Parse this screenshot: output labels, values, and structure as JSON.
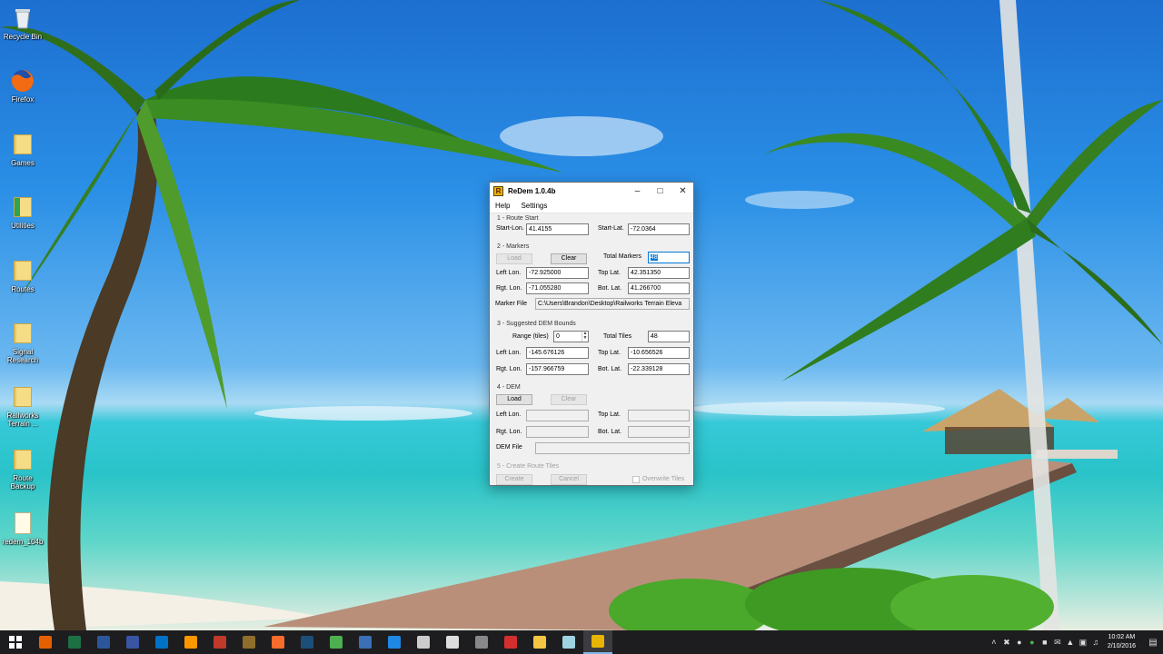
{
  "desktop": {
    "icons": [
      {
        "label": "Recycle Bin",
        "icon": "recycle-bin-icon"
      },
      {
        "label": "Firefox",
        "icon": "firefox-icon"
      },
      {
        "label": "Games",
        "icon": "folder-icon"
      },
      {
        "label": "Utilities",
        "icon": "folder-icon"
      },
      {
        "label": "Routes",
        "icon": "folder-icon"
      },
      {
        "label": "Signal",
        "label2": "Research",
        "icon": "folder-icon"
      },
      {
        "label": "Railworks",
        "label2": "Terrain ...",
        "icon": "folder-icon"
      },
      {
        "label": "Route",
        "label2": "Backup",
        "icon": "folder-icon"
      },
      {
        "label": "redem_104b",
        "icon": "file-icon"
      }
    ]
  },
  "window": {
    "title": "ReDem 1.0.4b",
    "app_icon_letter": "R",
    "menu": [
      "Help",
      "Settings"
    ],
    "sec1": {
      "title": "1 - Route Start",
      "start_lon_label": "Start-Lon.",
      "start_lon": "41.4155",
      "start_lat_label": "Start-Lat.",
      "start_lat": "-72.0364"
    },
    "sec2": {
      "title": "2 - Markers",
      "load": "Load",
      "clear": "Clear",
      "total_markers_label": "Total Markers",
      "total_markers": "48",
      "left_lon_label": "Left Lon.",
      "left_lon": "-72.925000",
      "top_lat_label": "Top Lat.",
      "top_lat": "42.351350",
      "rgt_lon_label": "Rgt. Lon.",
      "rgt_lon": "-71.055280",
      "bot_lat_label": "Bot. Lat.",
      "bot_lat": "41.266700",
      "marker_file_label": "Marker File",
      "marker_file": "C:\\Users\\Brandon\\Desktop\\Railworks Terrain Eleva"
    },
    "sec3": {
      "title": "3 - Suggested DEM Bounds",
      "range_label": "Range (tiles)",
      "range": "0",
      "total_tiles_label": "Total Tiles",
      "total_tiles": "48",
      "left_lon_label": "Left Lon.",
      "left_lon": "-145.676126",
      "top_lat_label": "Top Lat.",
      "top_lat": "-10.656526",
      "rgt_lon_label": "Rgt. Lon.",
      "rgt_lon": "-157.966759",
      "bot_lat_label": "Bot. Lat.",
      "bot_lat": "-22.339128"
    },
    "sec4": {
      "title": "4 - DEM",
      "load": "Load",
      "clear": "Clear",
      "left_lon_label": "Left Lon.",
      "top_lat_label": "Top Lat.",
      "rgt_lon_label": "Rgt. Lon.",
      "bot_lat_label": "Bot. Lat.",
      "dem_file_label": "DEM File"
    },
    "sec5": {
      "title": "5 - Create Route Tiles",
      "create": "Create",
      "cancel": "Cancel",
      "overwrite": "Overwrite Tiles"
    }
  },
  "taskbar": {
    "apps": [
      {
        "name": "firefox",
        "color": "#e66000"
      },
      {
        "name": "excel",
        "color": "#1d7044"
      },
      {
        "name": "word",
        "color": "#2b579a"
      },
      {
        "name": "visio",
        "color": "#3955a3"
      },
      {
        "name": "outlook",
        "color": "#0072c6"
      },
      {
        "name": "sublime",
        "color": "#ff9800"
      },
      {
        "name": "star-app",
        "color": "#c0392b"
      },
      {
        "name": "warcraft",
        "color": "#8d6e2a"
      },
      {
        "name": "origin",
        "color": "#f56c2d"
      },
      {
        "name": "steam",
        "color": "#1b4f7a"
      },
      {
        "name": "xsplit",
        "color": "#4caf50"
      },
      {
        "name": "globe-app",
        "color": "#3b6fb6"
      },
      {
        "name": "settings-app",
        "color": "#1e88e5"
      },
      {
        "name": "obs",
        "color": "#cccccc"
      },
      {
        "name": "cursor-app",
        "color": "#dddddd"
      },
      {
        "name": "inkscape",
        "color": "#888888"
      },
      {
        "name": "pdf-app",
        "color": "#d32f2f"
      },
      {
        "name": "file-explorer",
        "color": "#f4c542"
      },
      {
        "name": "notepad",
        "color": "#9fd3e0"
      },
      {
        "name": "redem",
        "color": "#e7b400"
      }
    ],
    "clock_time": "10:02 AM",
    "clock_date": "2/10/2016"
  }
}
